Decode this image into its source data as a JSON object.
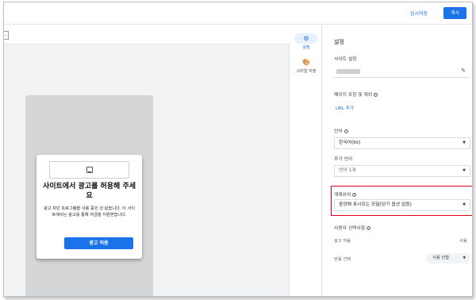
{
  "topbar": {
    "draft_label": "임시저장",
    "publish_label": "게시"
  },
  "canvas": {
    "toolbar_handle": "-",
    "dialog": {
      "title": "사이트에서 광고를 허용해 주세요",
      "body": "광고 차단 프로그램을 사용 중인 것 같습니다. 이 사이트에서는 광고를 통해 자금을 지원받습니다.",
      "button_label": "광고 허용"
    }
  },
  "sidetabs": {
    "items": [
      {
        "label": "설정",
        "icon": "gear-icon",
        "active": true
      },
      {
        "label": "스타일 지정",
        "icon": "palette-icon",
        "active": false
      }
    ]
  },
  "panel": {
    "title": "설정",
    "site_label": "사이트 설정",
    "pages_label": "페이지 포함 및 제외",
    "url_add_label": "URL 추가",
    "language_label": "언어",
    "language_value": "한국어(ko)",
    "extra_language_label": "추가 언어",
    "extra_language_value": "언어 1개",
    "placement_label": "게재위치",
    "placement_value": "중앙에 표시되는 모달(닫기 옵션 없음)",
    "user_choice_label": "사용자 선택사항",
    "ad_consent_label": "광고 허용",
    "ad_consent_value": "사용",
    "close_label": "닫음 선택",
    "close_value": "사용 안함"
  },
  "colors": {
    "accent": "#1a73e8",
    "highlight": "#e0001a"
  }
}
